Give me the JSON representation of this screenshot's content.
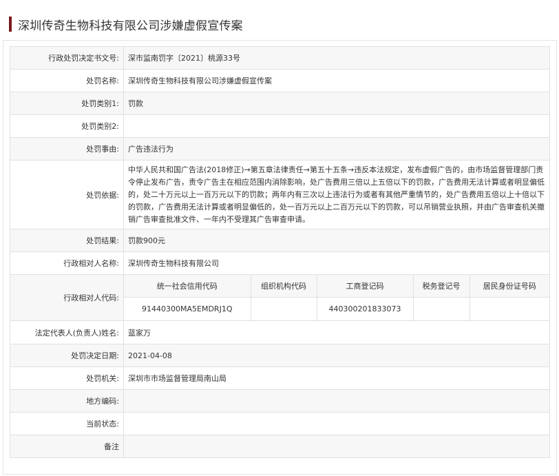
{
  "page_title": "深圳传奇生物科技有限公司涉嫌虚假宣传案",
  "rows": {
    "decision_no": {
      "label": "行政处罚决定书文号:",
      "value": "深市监南罚字〔2021〕桃源33号"
    },
    "penalty_name": {
      "label": "处罚名称:",
      "value": "深圳传奇生物科技有限公司涉嫌虚假宣传案"
    },
    "category1": {
      "label": "处罚类别1:",
      "value": "罚款"
    },
    "category2": {
      "label": "处罚类别2:",
      "value": ""
    },
    "reason": {
      "label": "处罚事由:",
      "value": "广告违法行为"
    },
    "basis": {
      "label": "处罚依据:",
      "value": "中华人民共和国广告法(2018修正)→第五章法律责任→第五十五条→违反本法规定，发布虚假广告的，由市场监督管理部门责令停止发布广告，责令广告主在相应范围内消除影响，处广告费用三倍以上五倍以下的罚款，广告费用无法计算或者明显偏低的，处二十万元以上一百万元以下的罚款；两年内有三次以上违法行为或者有其他严重情节的，处广告费用五倍以上十倍以下的罚款，广告费用无法计算或者明显偏低的，处一百万元以上二百万元以下的罚款，可以吊销营业执照，并由广告审查机关撤销广告审查批准文件、一年内不受理其广告审查申请。"
    },
    "result": {
      "label": "处罚结果:",
      "value": "罚款900元"
    },
    "party_name": {
      "label": "行政相对人名称:",
      "value": "深圳传奇生物科技有限公司"
    },
    "party_code": {
      "label": "行政相对人代码:",
      "headers": [
        "统一社会信用代码",
        "组织机构代码",
        "工商登记码",
        "税务登记号",
        "居民身份证号码"
      ],
      "values": [
        "91440300MA5EMDRJ1Q",
        "",
        "440300201833073",
        "",
        ""
      ]
    },
    "legal_rep": {
      "label": "法定代表人(负责人)姓名:",
      "value": "蓝家万"
    },
    "decision_date": {
      "label": "处罚决定日期:",
      "value": "2021-04-08"
    },
    "authority": {
      "label": "处罚机关:",
      "value": "深圳市市场监督管理局南山局"
    },
    "local_code": {
      "label": "地方编码:",
      "value": ""
    },
    "status": {
      "label": "当前状态:",
      "value": ""
    },
    "remark": {
      "label": "备注",
      "value": ""
    }
  }
}
